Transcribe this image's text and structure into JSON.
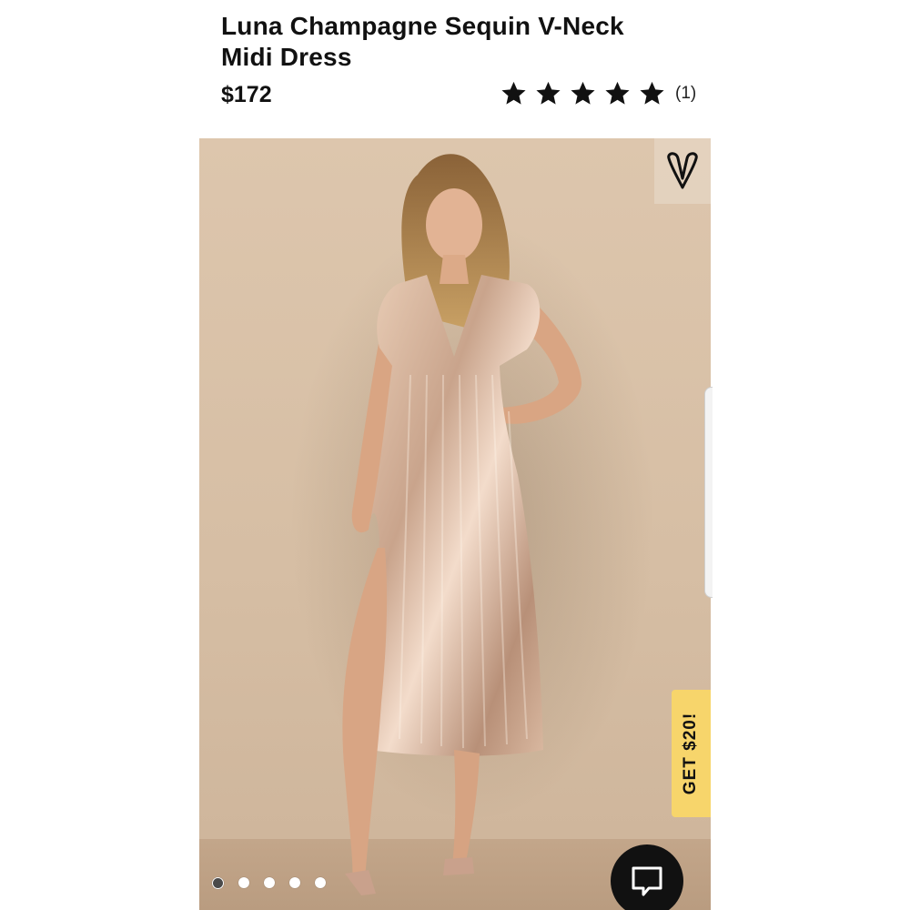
{
  "product": {
    "title_line1": "Luna Champagne Sequin V-Neck",
    "title_line2": "Midi Dress",
    "price": "$172",
    "rating": {
      "stars": 5,
      "max_stars": 5,
      "review_count_label": "(1)"
    }
  },
  "gallery": {
    "image_count": 5,
    "active_index": 0,
    "wishlist_icon": "heart-v-icon",
    "promo_label": "GET $20!"
  },
  "chat": {
    "icon": "chat-bubble-icon"
  },
  "colors": {
    "promo_bg": "#f7d56b",
    "chat_bg": "#111111",
    "photo_bg": "#d8c1a7"
  }
}
